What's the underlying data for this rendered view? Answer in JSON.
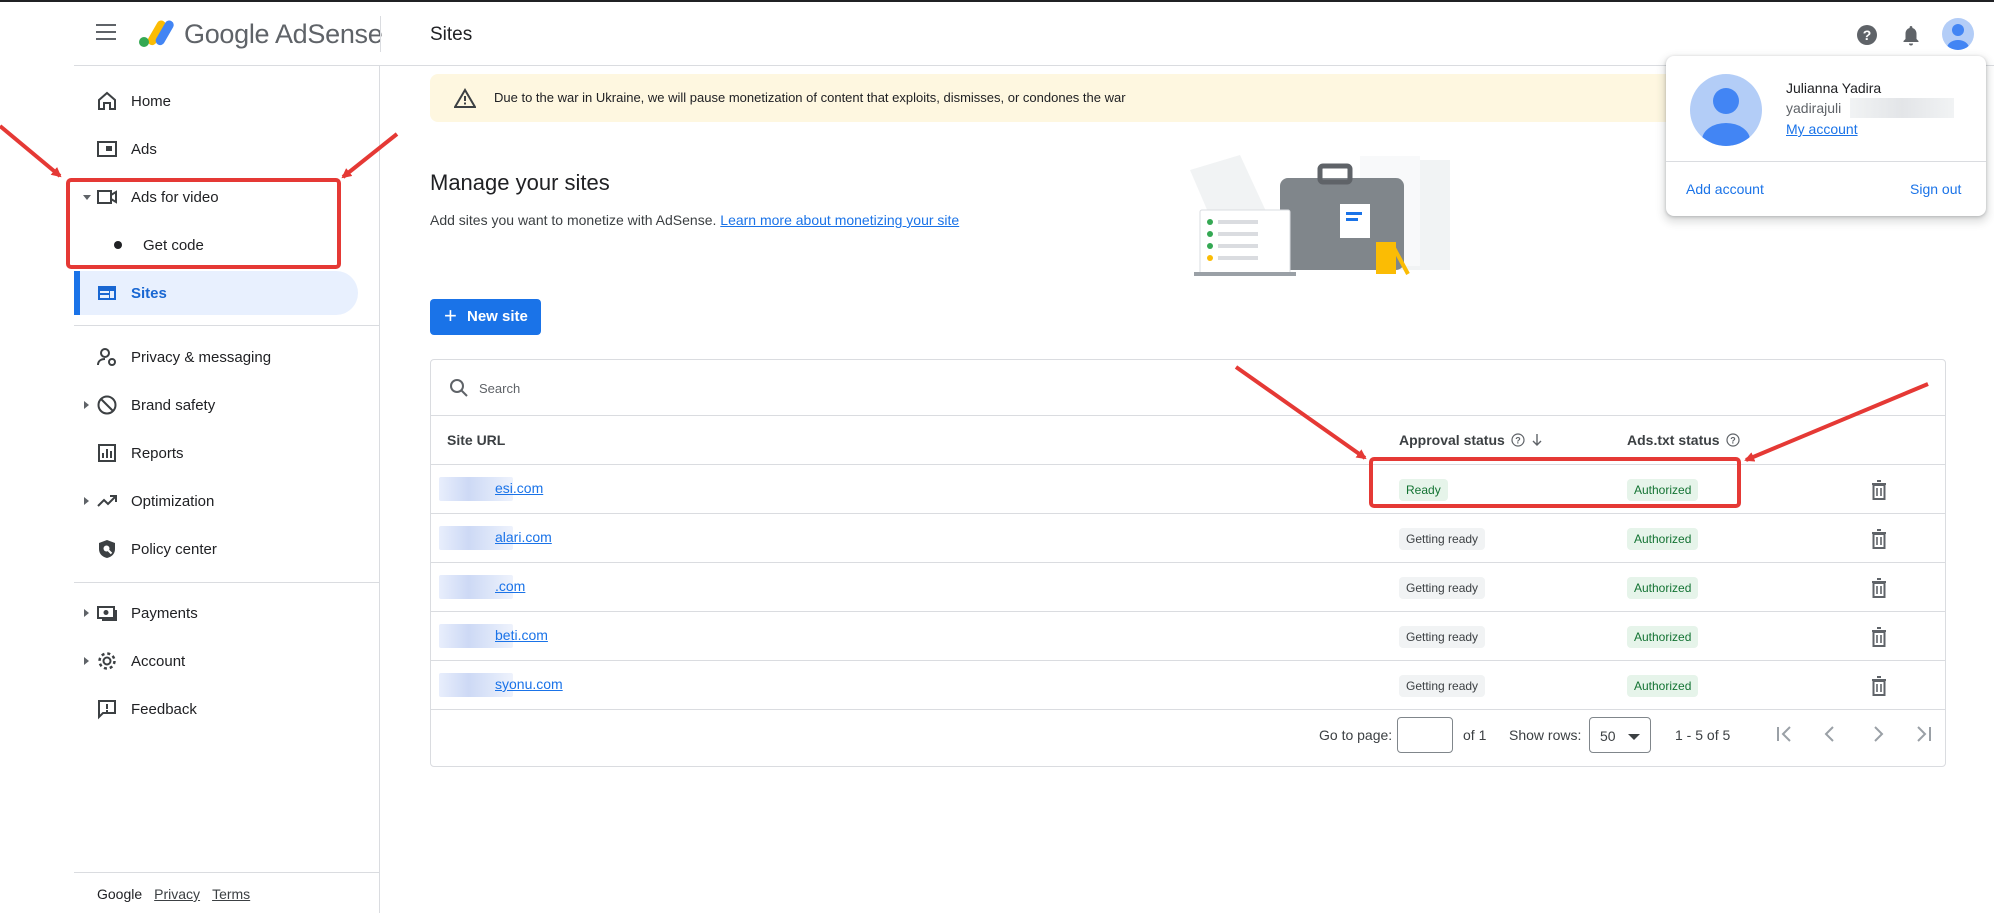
{
  "header": {
    "brand": "Google AdSense",
    "page_title": "Sites"
  },
  "sidebar": {
    "items": [
      {
        "label": "Home"
      },
      {
        "label": "Ads"
      },
      {
        "label": "Ads for video"
      },
      {
        "label": "Get code"
      },
      {
        "label": "Sites"
      },
      {
        "label": "Privacy & messaging"
      },
      {
        "label": "Brand safety"
      },
      {
        "label": "Reports"
      },
      {
        "label": "Optimization"
      },
      {
        "label": "Policy center"
      },
      {
        "label": "Payments"
      },
      {
        "label": "Account"
      },
      {
        "label": "Feedback"
      }
    ],
    "footer": {
      "google": "Google",
      "privacy": "Privacy",
      "terms": "Terms"
    }
  },
  "banner": {
    "text": "Due to the war in Ukraine, we will pause monetization of content that exploits, dismisses, or condones the war"
  },
  "main": {
    "heading": "Manage your sites",
    "subtitle": "Add sites you want to monetize with AdSense.",
    "learn_more": "Learn more about monetizing your site",
    "new_site_button": "New site",
    "search_placeholder": "Search",
    "columns": {
      "site_url": "Site URL",
      "approval": "Approval status",
      "ads_txt": "Ads.txt status"
    },
    "rows": [
      {
        "url": "esi.com",
        "approval": "Ready",
        "ads_txt": "Authorized"
      },
      {
        "url": "alari.com",
        "approval": "Getting ready",
        "ads_txt": "Authorized"
      },
      {
        "url": ".com",
        "approval": "Getting ready",
        "ads_txt": "Authorized"
      },
      {
        "url": "beti.com",
        "approval": "Getting ready",
        "ads_txt": "Authorized"
      },
      {
        "url": "syonu.com",
        "approval": "Getting ready",
        "ads_txt": "Authorized"
      }
    ],
    "pager": {
      "go_to_page": "Go to page:",
      "of_pages": "of 1",
      "show_rows": "Show rows:",
      "rows_value": "50",
      "range": "1 - 5 of 5"
    }
  },
  "account_popup": {
    "name": "Julianna Yadira",
    "email": "yadirajuli",
    "my_account": "My account",
    "add_account": "Add account",
    "sign_out": "Sign out"
  },
  "colors": {
    "accent": "#1a73e8",
    "annotation": "#e53935",
    "banner_bg": "#fef7e0",
    "ready_bg": "#e6f4ea",
    "ready_text": "#137333"
  },
  "icons": {
    "menu": "menu-icon",
    "help": "help-icon",
    "notifications": "bell-icon",
    "search": "search-icon",
    "delete": "trash-icon",
    "warning": "warning-icon"
  }
}
